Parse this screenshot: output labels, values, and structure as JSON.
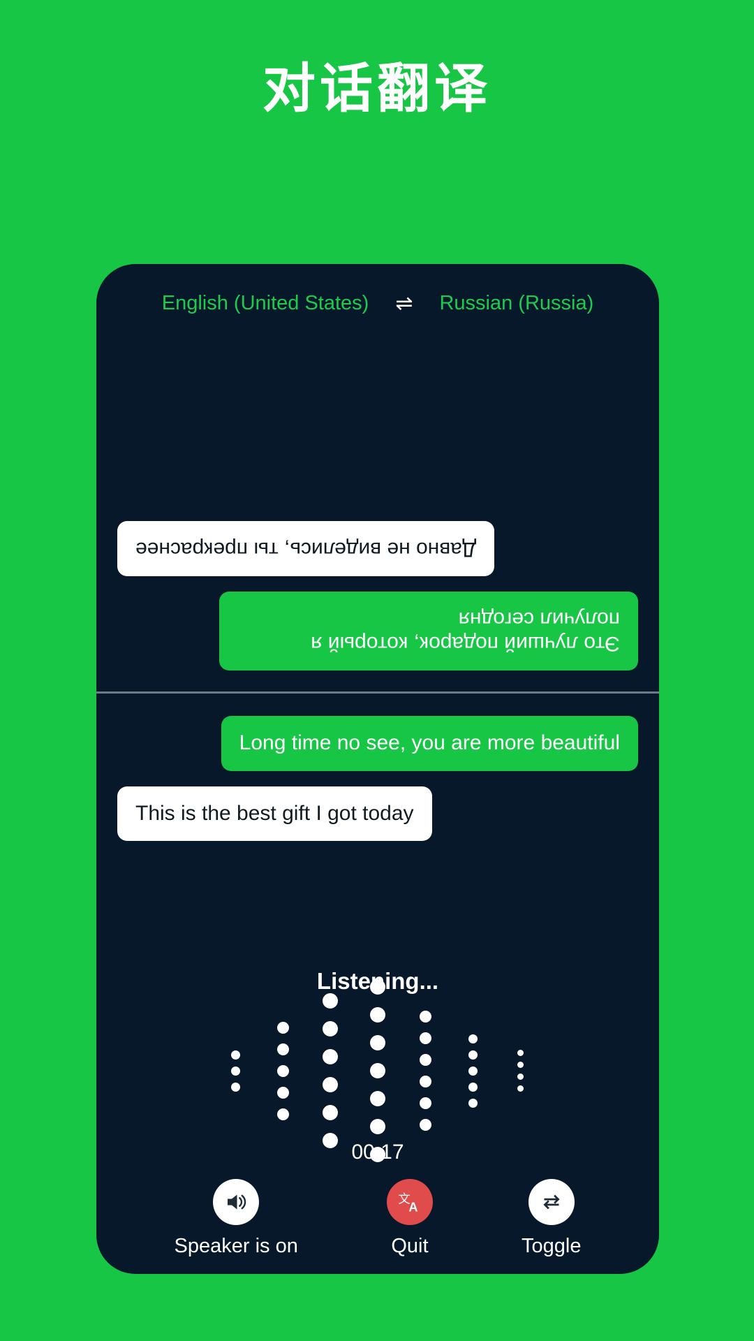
{
  "page": {
    "title": "对话翻译",
    "background_color": "#18c646",
    "card_color": "#07182a"
  },
  "languages": {
    "source": "English (United States)",
    "swap_icon": "⇌",
    "target": "Russian (Russia)",
    "accent_color": "#1ecb4d"
  },
  "conversation": {
    "remote_pane": {
      "orientation": "rotated-180",
      "messages": [
        {
          "text": "Это лучший подарок, который я получил сегодня",
          "style": "green",
          "align": "left"
        },
        {
          "text": "Давно не виделись, ты прекраснее",
          "style": "white",
          "align": "right"
        }
      ]
    },
    "local_pane": {
      "orientation": "normal",
      "messages": [
        {
          "text": "Long time no see, you are more beautiful",
          "style": "green",
          "align": "right"
        },
        {
          "text": "This is the best gift I got today",
          "style": "white",
          "align": "left"
        }
      ]
    }
  },
  "recording": {
    "status": "Listening...",
    "timer": "00:17",
    "waveform": {
      "columns": [
        {
          "count": 3,
          "size": 13
        },
        {
          "count": 5,
          "size": 17
        },
        {
          "count": 6,
          "size": 22
        },
        {
          "count": 7,
          "size": 22
        },
        {
          "count": 6,
          "size": 17
        },
        {
          "count": 5,
          "size": 13
        },
        {
          "count": 4,
          "size": 9
        }
      ],
      "dot_color": "#ffffff"
    }
  },
  "controls": [
    {
      "id": "speaker",
      "label": "Speaker is on",
      "icon": "speaker-icon",
      "circle_color": "#ffffff"
    },
    {
      "id": "quit",
      "label": "Quit",
      "icon": "translate-icon",
      "circle_color": "#e04b4b"
    },
    {
      "id": "toggle",
      "label": "Toggle",
      "icon": "swap-arrows-icon",
      "circle_color": "#ffffff"
    }
  ]
}
